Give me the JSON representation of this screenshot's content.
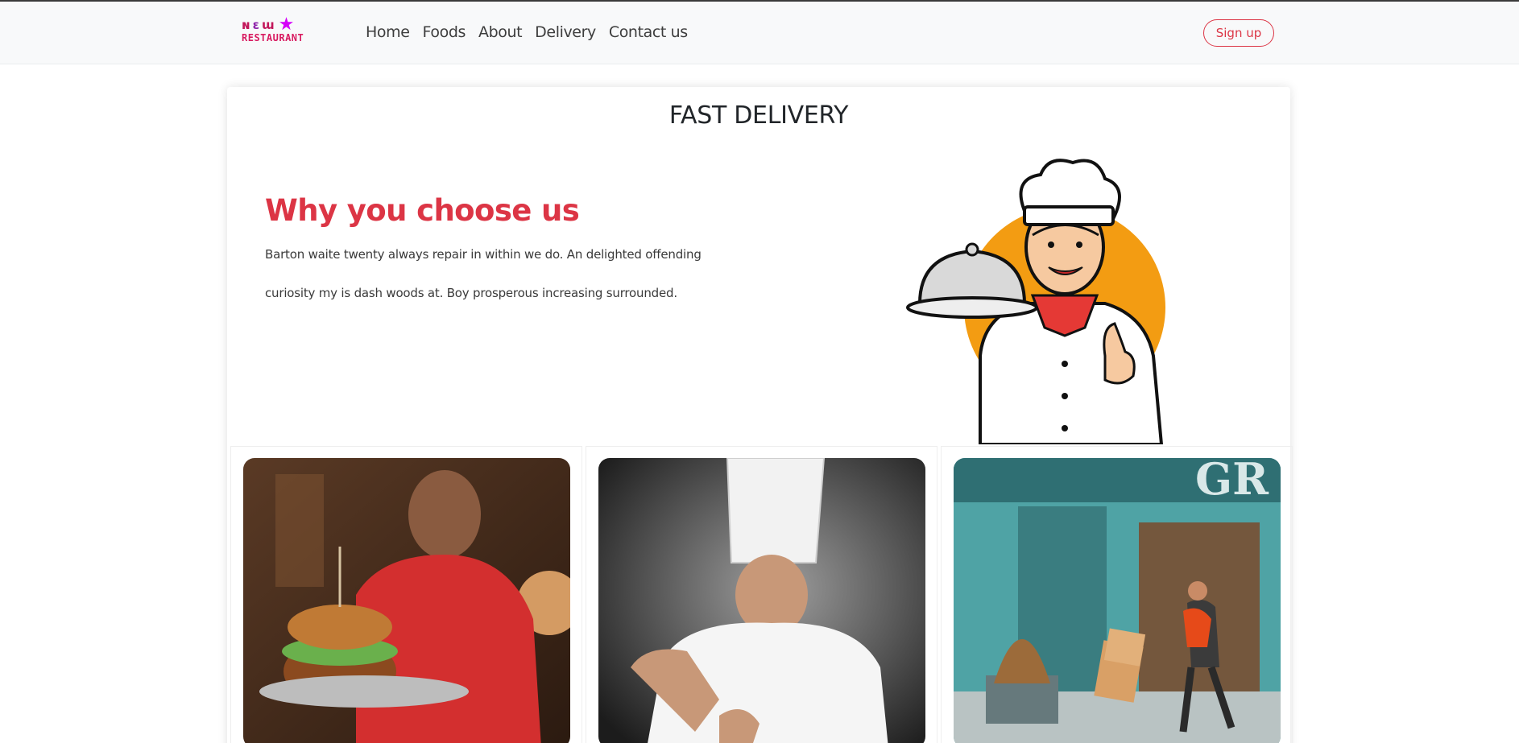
{
  "navbar": {
    "logo": {
      "top": "NEW",
      "bottom": "RESTAURANT"
    },
    "links": [
      "Home",
      "Foods",
      "About",
      "Delivery",
      "Contact us"
    ],
    "signup": "Sign up"
  },
  "section": {
    "title": "FAST DELIVERY",
    "heading": "Why you choose us",
    "description": "Barton waite twenty always repair in within we do. An delighted offending curiosity my is dash woods at. Boy prosperous increasing surrounded."
  },
  "colors": {
    "accent": "#dc3545",
    "chef_circle": "#f39c12",
    "logo": "#d81b60"
  },
  "photos": [
    {
      "icon": "waiter-burger-photo"
    },
    {
      "icon": "chef-cooking-photo"
    },
    {
      "icon": "delivery-man-photo"
    }
  ]
}
